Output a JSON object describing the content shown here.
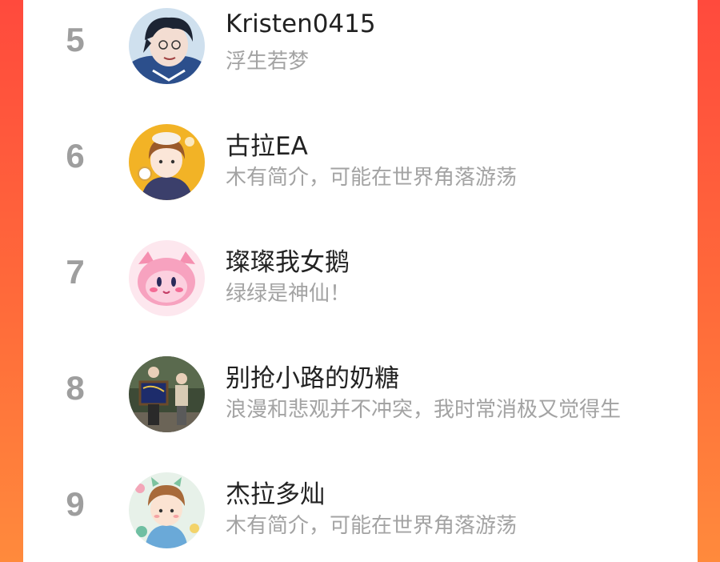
{
  "users": [
    {
      "rank": "5",
      "name": "Kristen0415",
      "bio": "浮生若梦"
    },
    {
      "rank": "6",
      "name": "古拉EA",
      "bio": "木有简介，可能在世界角落游荡"
    },
    {
      "rank": "7",
      "name": "璨璨我女鹅",
      "bio": "绿绿是神仙！"
    },
    {
      "rank": "8",
      "name": "别抢小路的奶糖",
      "bio": "浪漫和悲观并不冲突，我时常消极又觉得生"
    },
    {
      "rank": "9",
      "name": "杰拉多灿",
      "bio": "木有简介，可能在世界角落游荡"
    }
  ],
  "colors": {
    "background_start": "#ff4a3d",
    "background_end": "#ff8a3c",
    "rank": "#9e9e9e",
    "name": "#222222",
    "bio": "#a3a3a3"
  }
}
